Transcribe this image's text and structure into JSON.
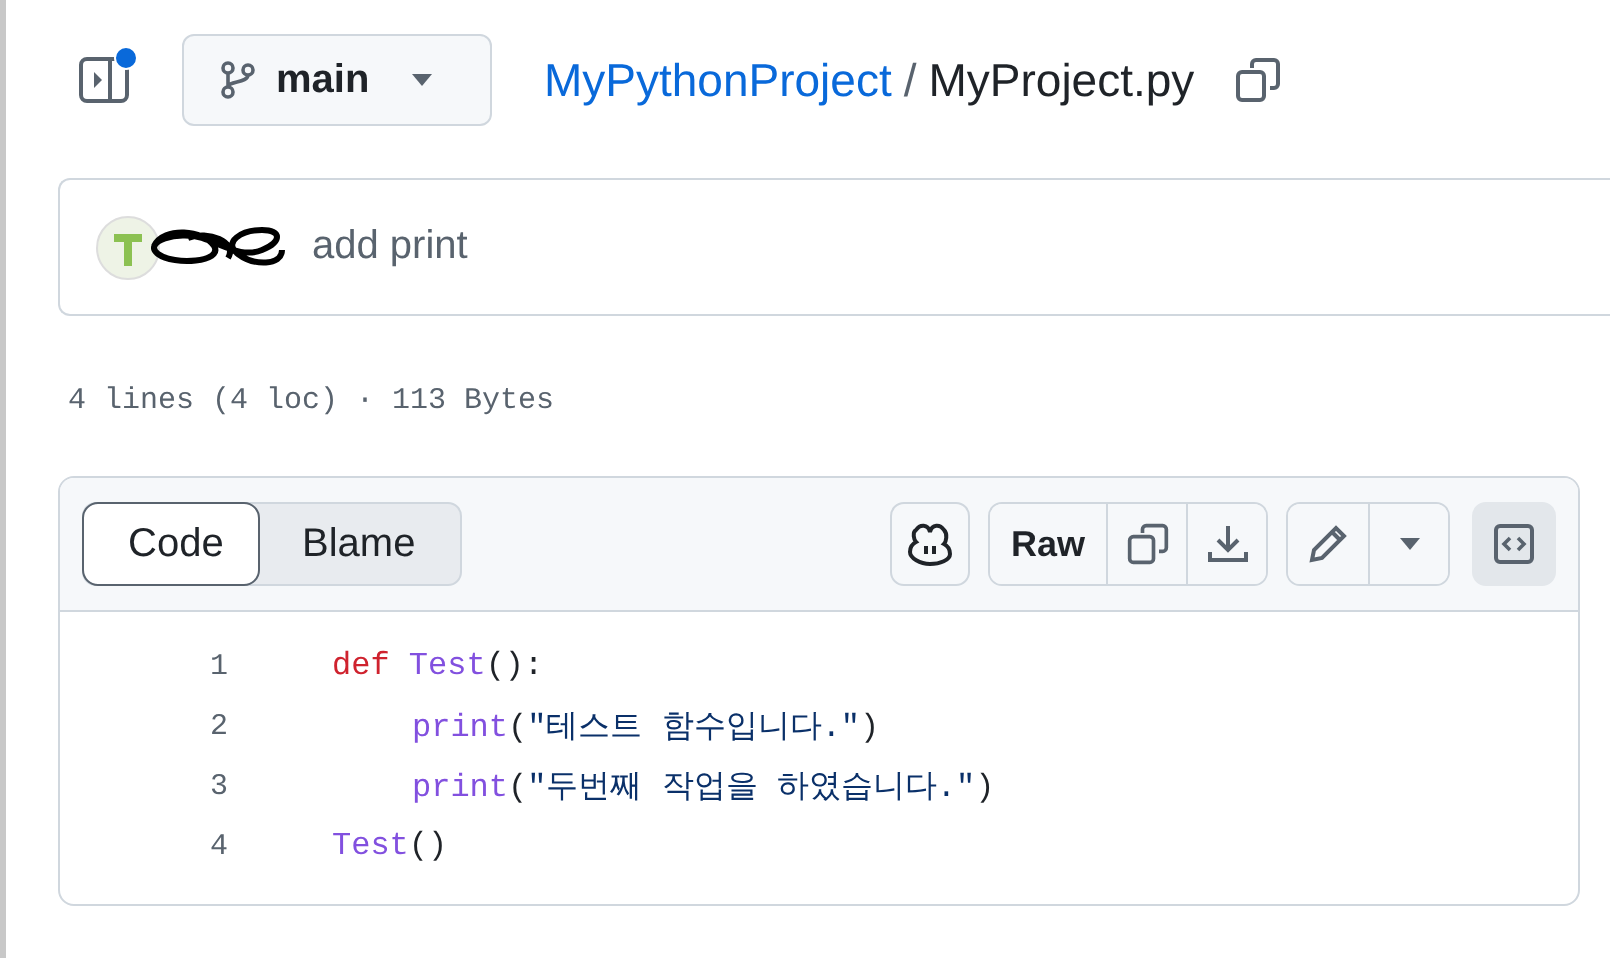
{
  "header": {
    "sidebar_notification": true,
    "branch": "main",
    "breadcrumb": {
      "repo": "MyPythonProject",
      "separator": "/",
      "file": "MyProject.py"
    }
  },
  "commit": {
    "message": "add print"
  },
  "file_info": "4 lines (4 loc) · 113 Bytes",
  "tabs": [
    {
      "label": "Code",
      "selected": true
    },
    {
      "label": "Blame",
      "selected": false
    }
  ],
  "toolbar": {
    "raw": "Raw"
  },
  "code_lines": [
    {
      "number": "1",
      "tokens": [
        {
          "kind": "keyword",
          "text": "def "
        },
        {
          "kind": "function",
          "text": "Test"
        },
        {
          "kind": "plain",
          "text": "():"
        }
      ]
    },
    {
      "number": "2",
      "indented": true,
      "tokens": [
        {
          "kind": "function",
          "text": "print"
        },
        {
          "kind": "plain",
          "text": "("
        },
        {
          "kind": "string",
          "text": "\"테스트 함수입니다.\""
        },
        {
          "kind": "plain",
          "text": ")"
        }
      ]
    },
    {
      "number": "3",
      "indented": true,
      "tokens": [
        {
          "kind": "function",
          "text": "print"
        },
        {
          "kind": "plain",
          "text": "("
        },
        {
          "kind": "string",
          "text": "\"두번째 작업을 하였습니다.\""
        },
        {
          "kind": "plain",
          "text": ")"
        }
      ]
    },
    {
      "number": "4",
      "tokens": [
        {
          "kind": "function",
          "text": "Test"
        },
        {
          "kind": "plain",
          "text": "()"
        }
      ]
    }
  ]
}
